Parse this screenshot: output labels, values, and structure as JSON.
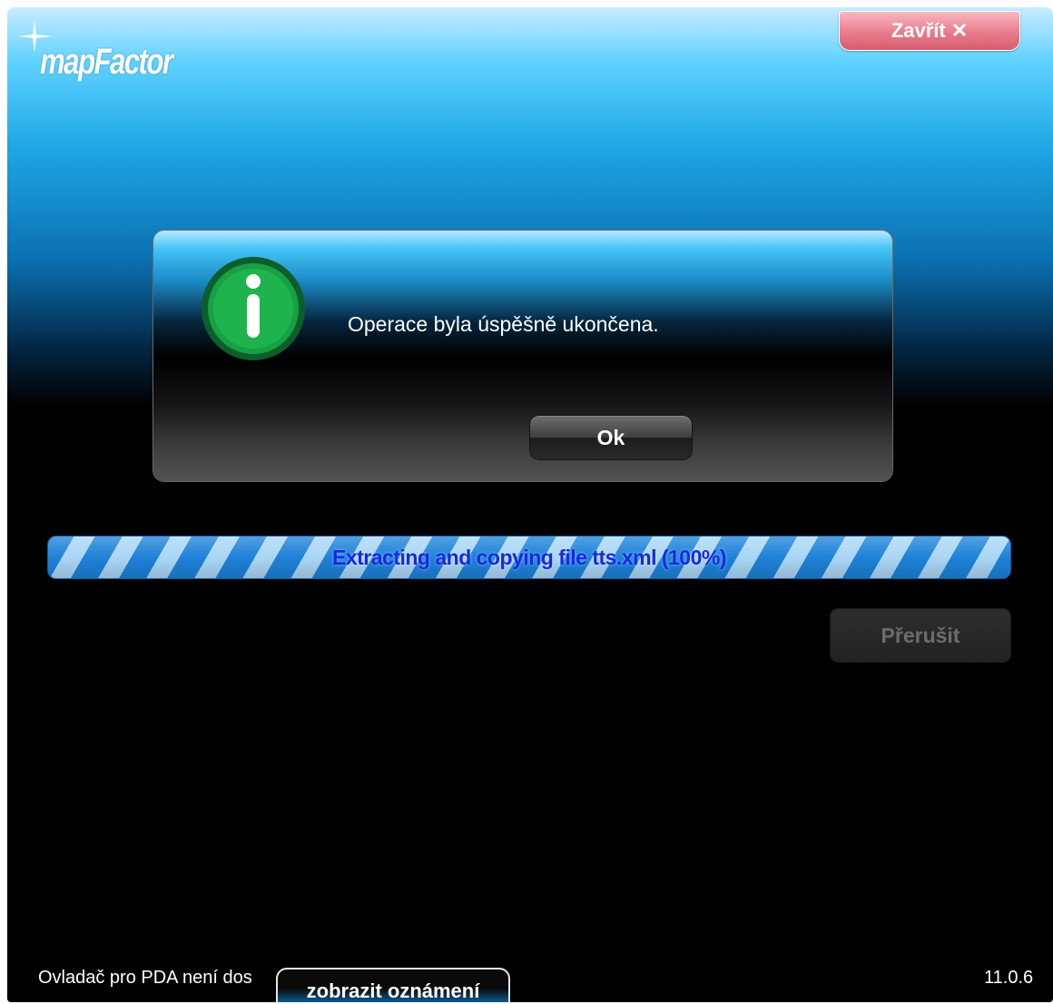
{
  "header": {
    "logo_text": "mapFactor",
    "close_label": "Zavřít"
  },
  "dialog": {
    "message": "Operace byla úspěšně ukončena.",
    "ok_label": "Ok",
    "icon": "info-icon"
  },
  "progress": {
    "label": "Extracting and copying file tts.xml (100%)",
    "percent": 100
  },
  "actions": {
    "cancel_label": "Přerušit"
  },
  "footer": {
    "status": "Ovladač pro PDA není dostupný",
    "tab_label": "zobrazit oznámení",
    "version": "11.0.6"
  },
  "colors": {
    "close_button": "#e97b8b",
    "progress_stripe": "#1d82d8",
    "progress_text": "#1428e8",
    "info_icon": "#17a044"
  }
}
